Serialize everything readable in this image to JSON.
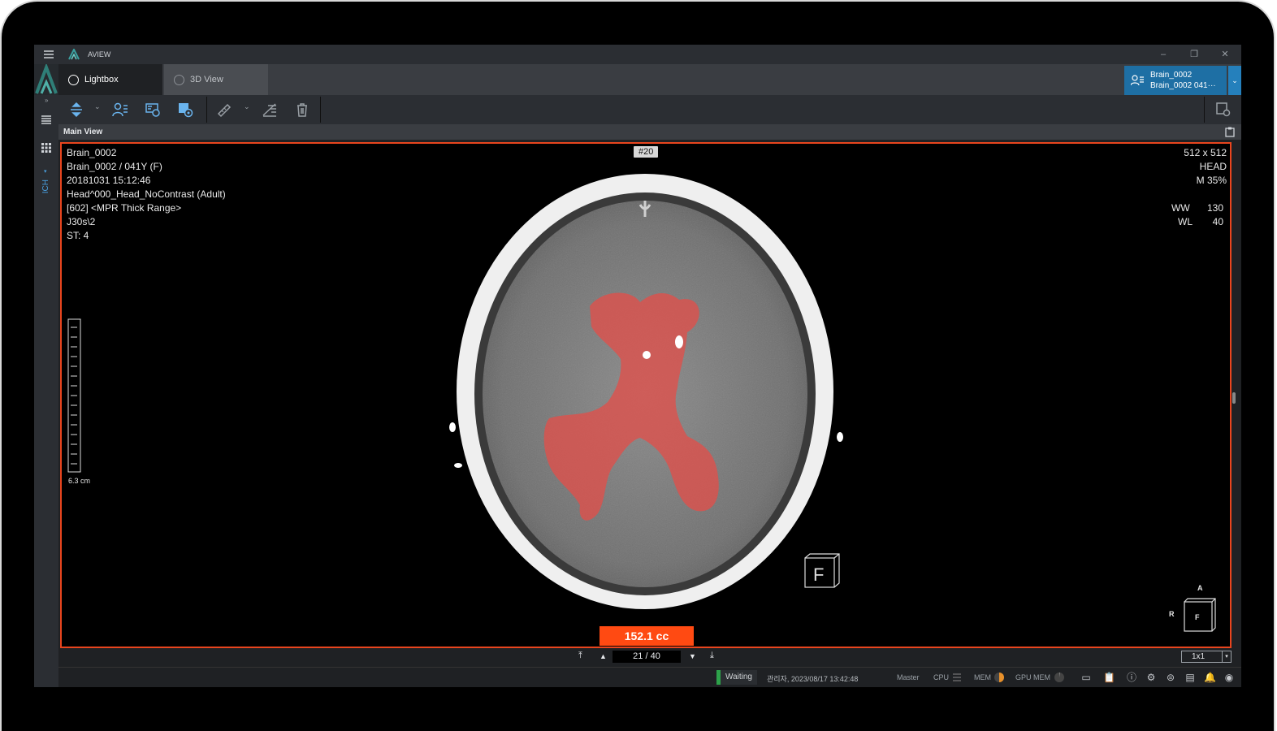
{
  "app": {
    "title": "AVIEW"
  },
  "tabs": [
    {
      "label": "Lightbox",
      "active": true
    },
    {
      "label": "3D View",
      "active": false
    }
  ],
  "patient_selector": {
    "line1": "Brain_0002",
    "line2": "Brain_0002 041···"
  },
  "side": {
    "ich_label": "ICH"
  },
  "main_view": {
    "title": "Main View"
  },
  "overlay": {
    "top_left": [
      "Brain_0002",
      "Brain_0002 / 041Y (F)",
      "20181031 15:12:46",
      "Head^000_Head_NoContrast (Adult)",
      "[602] <MPR Thick Range>",
      "J30s\\2",
      "ST: 4"
    ],
    "frame": "#20",
    "matrix": "512 x 512",
    "region": "HEAD",
    "zoom": "M 35%",
    "ww_label": "WW",
    "ww_value": "130",
    "wl_label": "WL",
    "wl_value": "40",
    "scale_label": "6.3 cm",
    "volume": "152.1 cc",
    "orient_a": "A",
    "orient_r": "R",
    "orient_f": "F",
    "marker_f": "F"
  },
  "navigator": {
    "pages": "21 / 40",
    "layout": "1x1"
  },
  "status": {
    "state": "Waiting",
    "user_time": "관리자, 2023/08/17 13:42:48",
    "master": "Master",
    "cpu": "CPU",
    "mem": "MEM",
    "gpu_mem": "GPU MEM"
  },
  "colors": {
    "accent": "#1e6fa4",
    "viewport_border": "#e8451e",
    "volume_bg": "#ff4a12",
    "mask": "#e0504a"
  }
}
